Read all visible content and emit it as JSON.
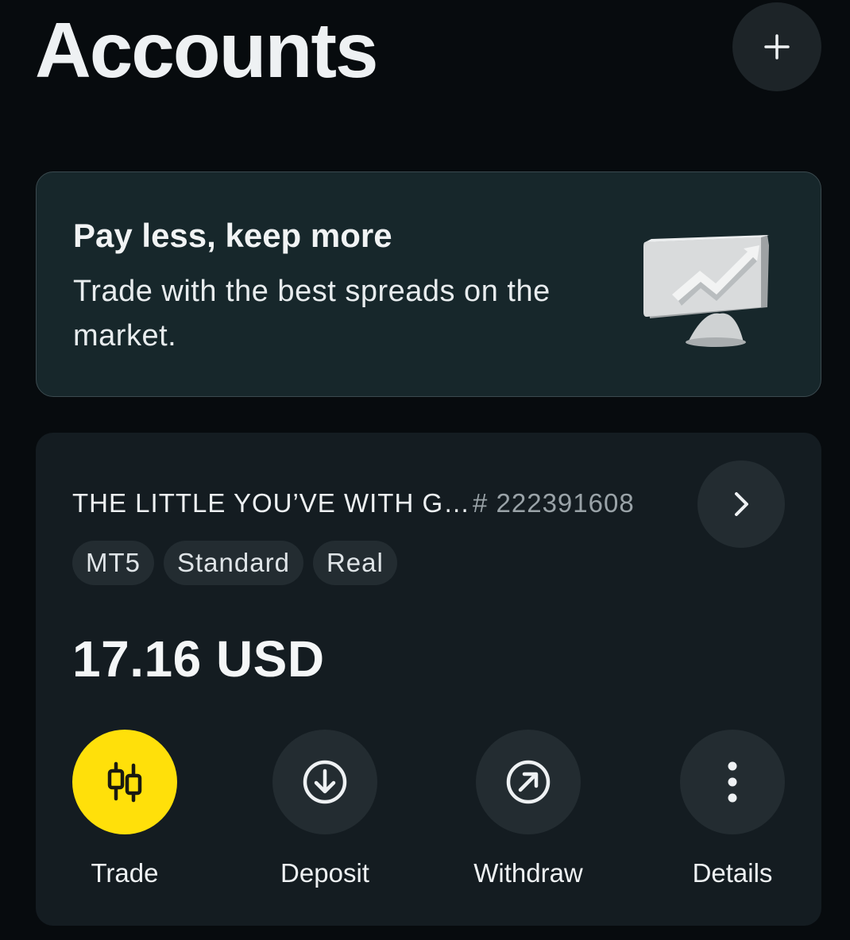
{
  "header": {
    "title": "Accounts",
    "add_icon": "plus-icon"
  },
  "promo": {
    "title": "Pay less, keep more",
    "text": "Trade with the best spreads on the market.",
    "illustration": "monitor-chart-illustration"
  },
  "account": {
    "name": "THE LITTLE YOU’VE WITH G…",
    "number": "# 222391608",
    "badges": [
      "MT5",
      "Standard",
      "Real"
    ],
    "balance": "17.16 USD",
    "actions": [
      {
        "label": "Trade",
        "icon": "candlestick-icon"
      },
      {
        "label": "Deposit",
        "icon": "arrow-down-circle-icon"
      },
      {
        "label": "Withdraw",
        "icon": "arrow-up-right-circle-icon"
      },
      {
        "label": "Details",
        "icon": "more-vertical-icon"
      }
    ]
  },
  "colors": {
    "background": "#070b0e",
    "card": "#141c21",
    "promo_card": "#17272b",
    "accent_yellow": "#ffe00a"
  }
}
